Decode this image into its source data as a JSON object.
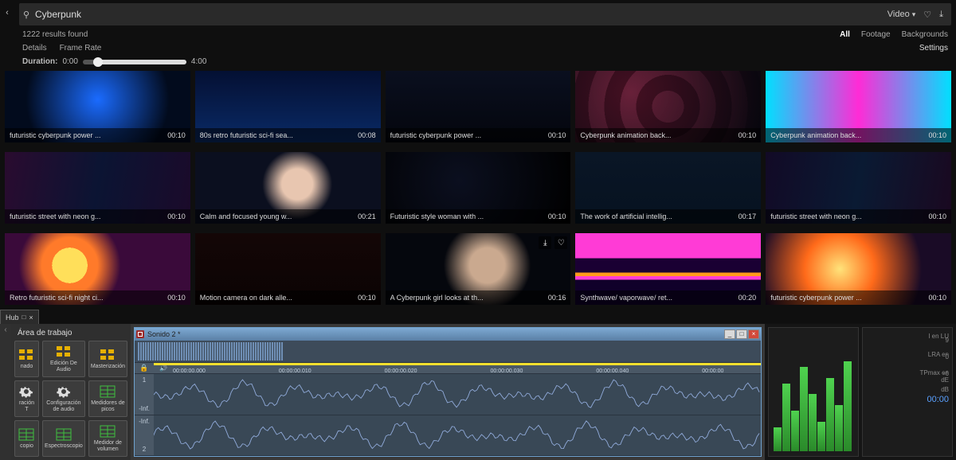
{
  "search": {
    "value": "Cyberpunk",
    "type_label": "Video"
  },
  "results_found": "1222 results found",
  "filters": [
    "All",
    "Footage",
    "Backgrounds"
  ],
  "filters_active": 0,
  "tabs": [
    "Details",
    "Frame Rate"
  ],
  "settings_label": "Settings",
  "duration": {
    "label": "Duration:",
    "min": "0:00",
    "max": "4:00"
  },
  "cards": [
    {
      "title": "futuristic cyberpunk power ...",
      "time": "00:10",
      "style": "b1"
    },
    {
      "title": "80s retro futuristic sci-fi sea...",
      "time": "00:08",
      "style": "b2"
    },
    {
      "title": "futuristic cyberpunk power ...",
      "time": "00:10",
      "style": "b3"
    },
    {
      "title": "Cyberpunk animation back...",
      "time": "00:10",
      "style": "b4"
    },
    {
      "title": "Cyberpunk animation back...",
      "time": "00:10",
      "style": "b5"
    },
    {
      "title": "futuristic street with neon g...",
      "time": "00:10",
      "style": "b6"
    },
    {
      "title": "Calm and focused young w...",
      "time": "00:21",
      "style": "b7"
    },
    {
      "title": "Futuristic style woman with ...",
      "time": "00:10",
      "style": "b8"
    },
    {
      "title": "The work of artificial intellig...",
      "time": "00:17",
      "style": "b9"
    },
    {
      "title": "futuristic street with neon g...",
      "time": "00:10",
      "style": "b10"
    },
    {
      "title": "Retro futuristic sci-fi night ci...",
      "time": "00:10",
      "style": "b11"
    },
    {
      "title": "Motion camera on dark alle...",
      "time": "00:10",
      "style": "b12"
    },
    {
      "title": "A Cyberpunk girl looks at th...",
      "time": "00:16",
      "style": "b13",
      "icons": true
    },
    {
      "title": "Synthwave/ vaporwave/ ret...",
      "time": "00:20",
      "style": "b14"
    },
    {
      "title": "futuristic cyberpunk power ...",
      "time": "00:10",
      "style": "b15"
    }
  ],
  "hub_tab": "Hub",
  "workspace": {
    "title": "Área de trabajo",
    "buttons": [
      {
        "label": "nado",
        "icon": "grid-y"
      },
      {
        "label": "Edición De Audio",
        "icon": "grid-y"
      },
      {
        "label": "Masterización",
        "icon": "grid-y"
      },
      {
        "label": "ración T",
        "icon": "gear"
      },
      {
        "label": "Configuración de audio",
        "icon": "gear"
      },
      {
        "label": "Medidores de picos",
        "icon": "table-g"
      },
      {
        "label": "copio",
        "icon": "table-g"
      },
      {
        "label": "Espectroscopio",
        "icon": "table-g"
      },
      {
        "label": "Medidor de volumen",
        "icon": "table-g"
      }
    ]
  },
  "audio_window": {
    "title": "Sonido 2 *",
    "ruler": [
      "00:00:00.000",
      "00:00:00.010",
      "00:00:00.020",
      "00:00:00.030",
      "00:00:00.040",
      "00:00:00"
    ],
    "track_top_db": "-Inf.",
    "track_bot_db": "-Inf.",
    "track1": "1",
    "track2": "2"
  },
  "readout": {
    "scale_top": "9",
    "scale_mid": "0",
    "scale_low": "-6",
    "unit": "dB",
    "l1": "I en LU",
    "l2": "LRA en",
    "l3": "TPmax en dE",
    "tc": "00:00"
  }
}
